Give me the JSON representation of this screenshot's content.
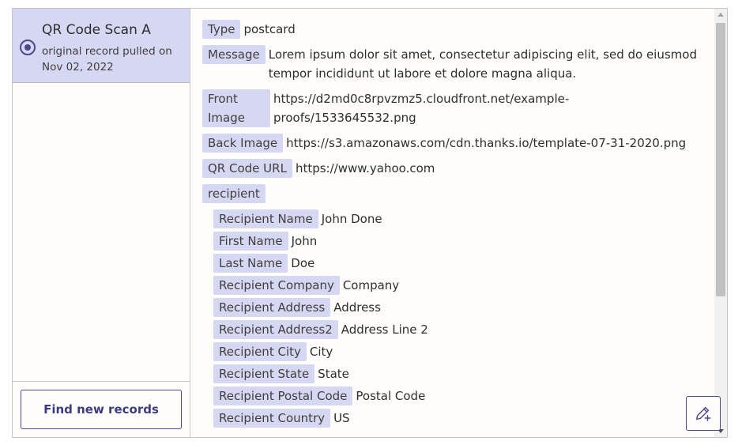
{
  "record": {
    "title": "QR Code Scan A",
    "subtitle": "original record pulled on Nov 02, 2022"
  },
  "actions": {
    "find_new_records": "Find new records"
  },
  "fields": [
    {
      "label": "Type",
      "value": "postcard"
    },
    {
      "label": "Message",
      "value": "Lorem ipsum dolor sit amet, consectetur adipiscing elit, sed do eiusmod tempor incididunt ut labore et dolore magna aliqua."
    },
    {
      "label": "Front Image",
      "value": "https://d2md0c8rpvzmz5.cloudfront.net/example-proofs/1533645532.png"
    },
    {
      "label": "Back Image",
      "value": "https://s3.amazonaws.com/cdn.thanks.io/template-07-31-2020.png"
    },
    {
      "label": "QR Code URL",
      "value": "https://www.yahoo.com"
    }
  ],
  "recipient": {
    "label": "recipient",
    "fields": [
      {
        "label": "Recipient Name",
        "value": "John Done"
      },
      {
        "label": "First Name",
        "value": "John"
      },
      {
        "label": "Last Name",
        "value": "Doe"
      },
      {
        "label": "Recipient Company",
        "value": "Company"
      },
      {
        "label": "Recipient Address",
        "value": "Address"
      },
      {
        "label": "Recipient Address2",
        "value": "Address Line 2"
      },
      {
        "label": "Recipient City",
        "value": "City"
      },
      {
        "label": "Recipient State",
        "value": "State"
      },
      {
        "label": "Recipient Postal Code",
        "value": "Postal Code"
      },
      {
        "label": "Recipient Country",
        "value": "US"
      }
    ]
  },
  "icons": {
    "record_selected": "radio-selected-icon",
    "edit": "pencil-plus-icon"
  },
  "colors": {
    "accent": "#4a4a8a",
    "tag_bg": "#d6d7f2",
    "text": "#403f3e"
  }
}
